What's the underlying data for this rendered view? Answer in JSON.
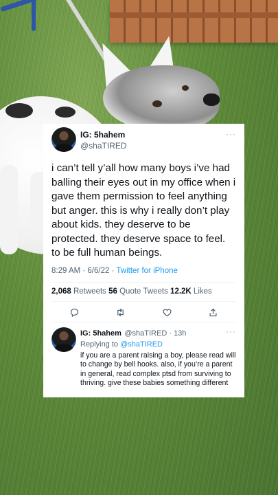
{
  "tweet": {
    "author_name": "IG: 5hahem",
    "author_handle": "@shaTIRED",
    "more": "···",
    "text": "i can’t tell y’all how many boys i’ve had balling their eyes out in my office when i gave them permission to feel anything but anger. this is why i really don’t play about kids. they deserve to be protected. they deserve space to feel. to be full human beings.",
    "time": "8:29 AM · 6/6/22 · ",
    "source": "Twitter for iPhone",
    "retweets_count": "2,068",
    "retweets_label": " Retweets ",
    "quotes_count": "56",
    "quotes_label": " Quote Tweets ",
    "likes_count": "12.2K",
    "likes_label": " Likes"
  },
  "reply": {
    "author_name": "IG: 5hahem",
    "author_handle": "@shaTIRED · 13h",
    "more": "···",
    "replying_label": "Replying to ",
    "replying_handle": "@shaTIRED",
    "text": "if you are a parent raising a boy, please read will to change by bell hooks. also, if you’re a parent in general, read complex ptsd from surviving to thriving. give these babies something different"
  },
  "icons": [
    "reply-icon",
    "retweet-icon",
    "like-icon",
    "share-icon"
  ],
  "colors": {
    "link": "#1d9bf0",
    "secondary_text": "#536471",
    "text": "#0f1419",
    "card": "#ffffff"
  }
}
